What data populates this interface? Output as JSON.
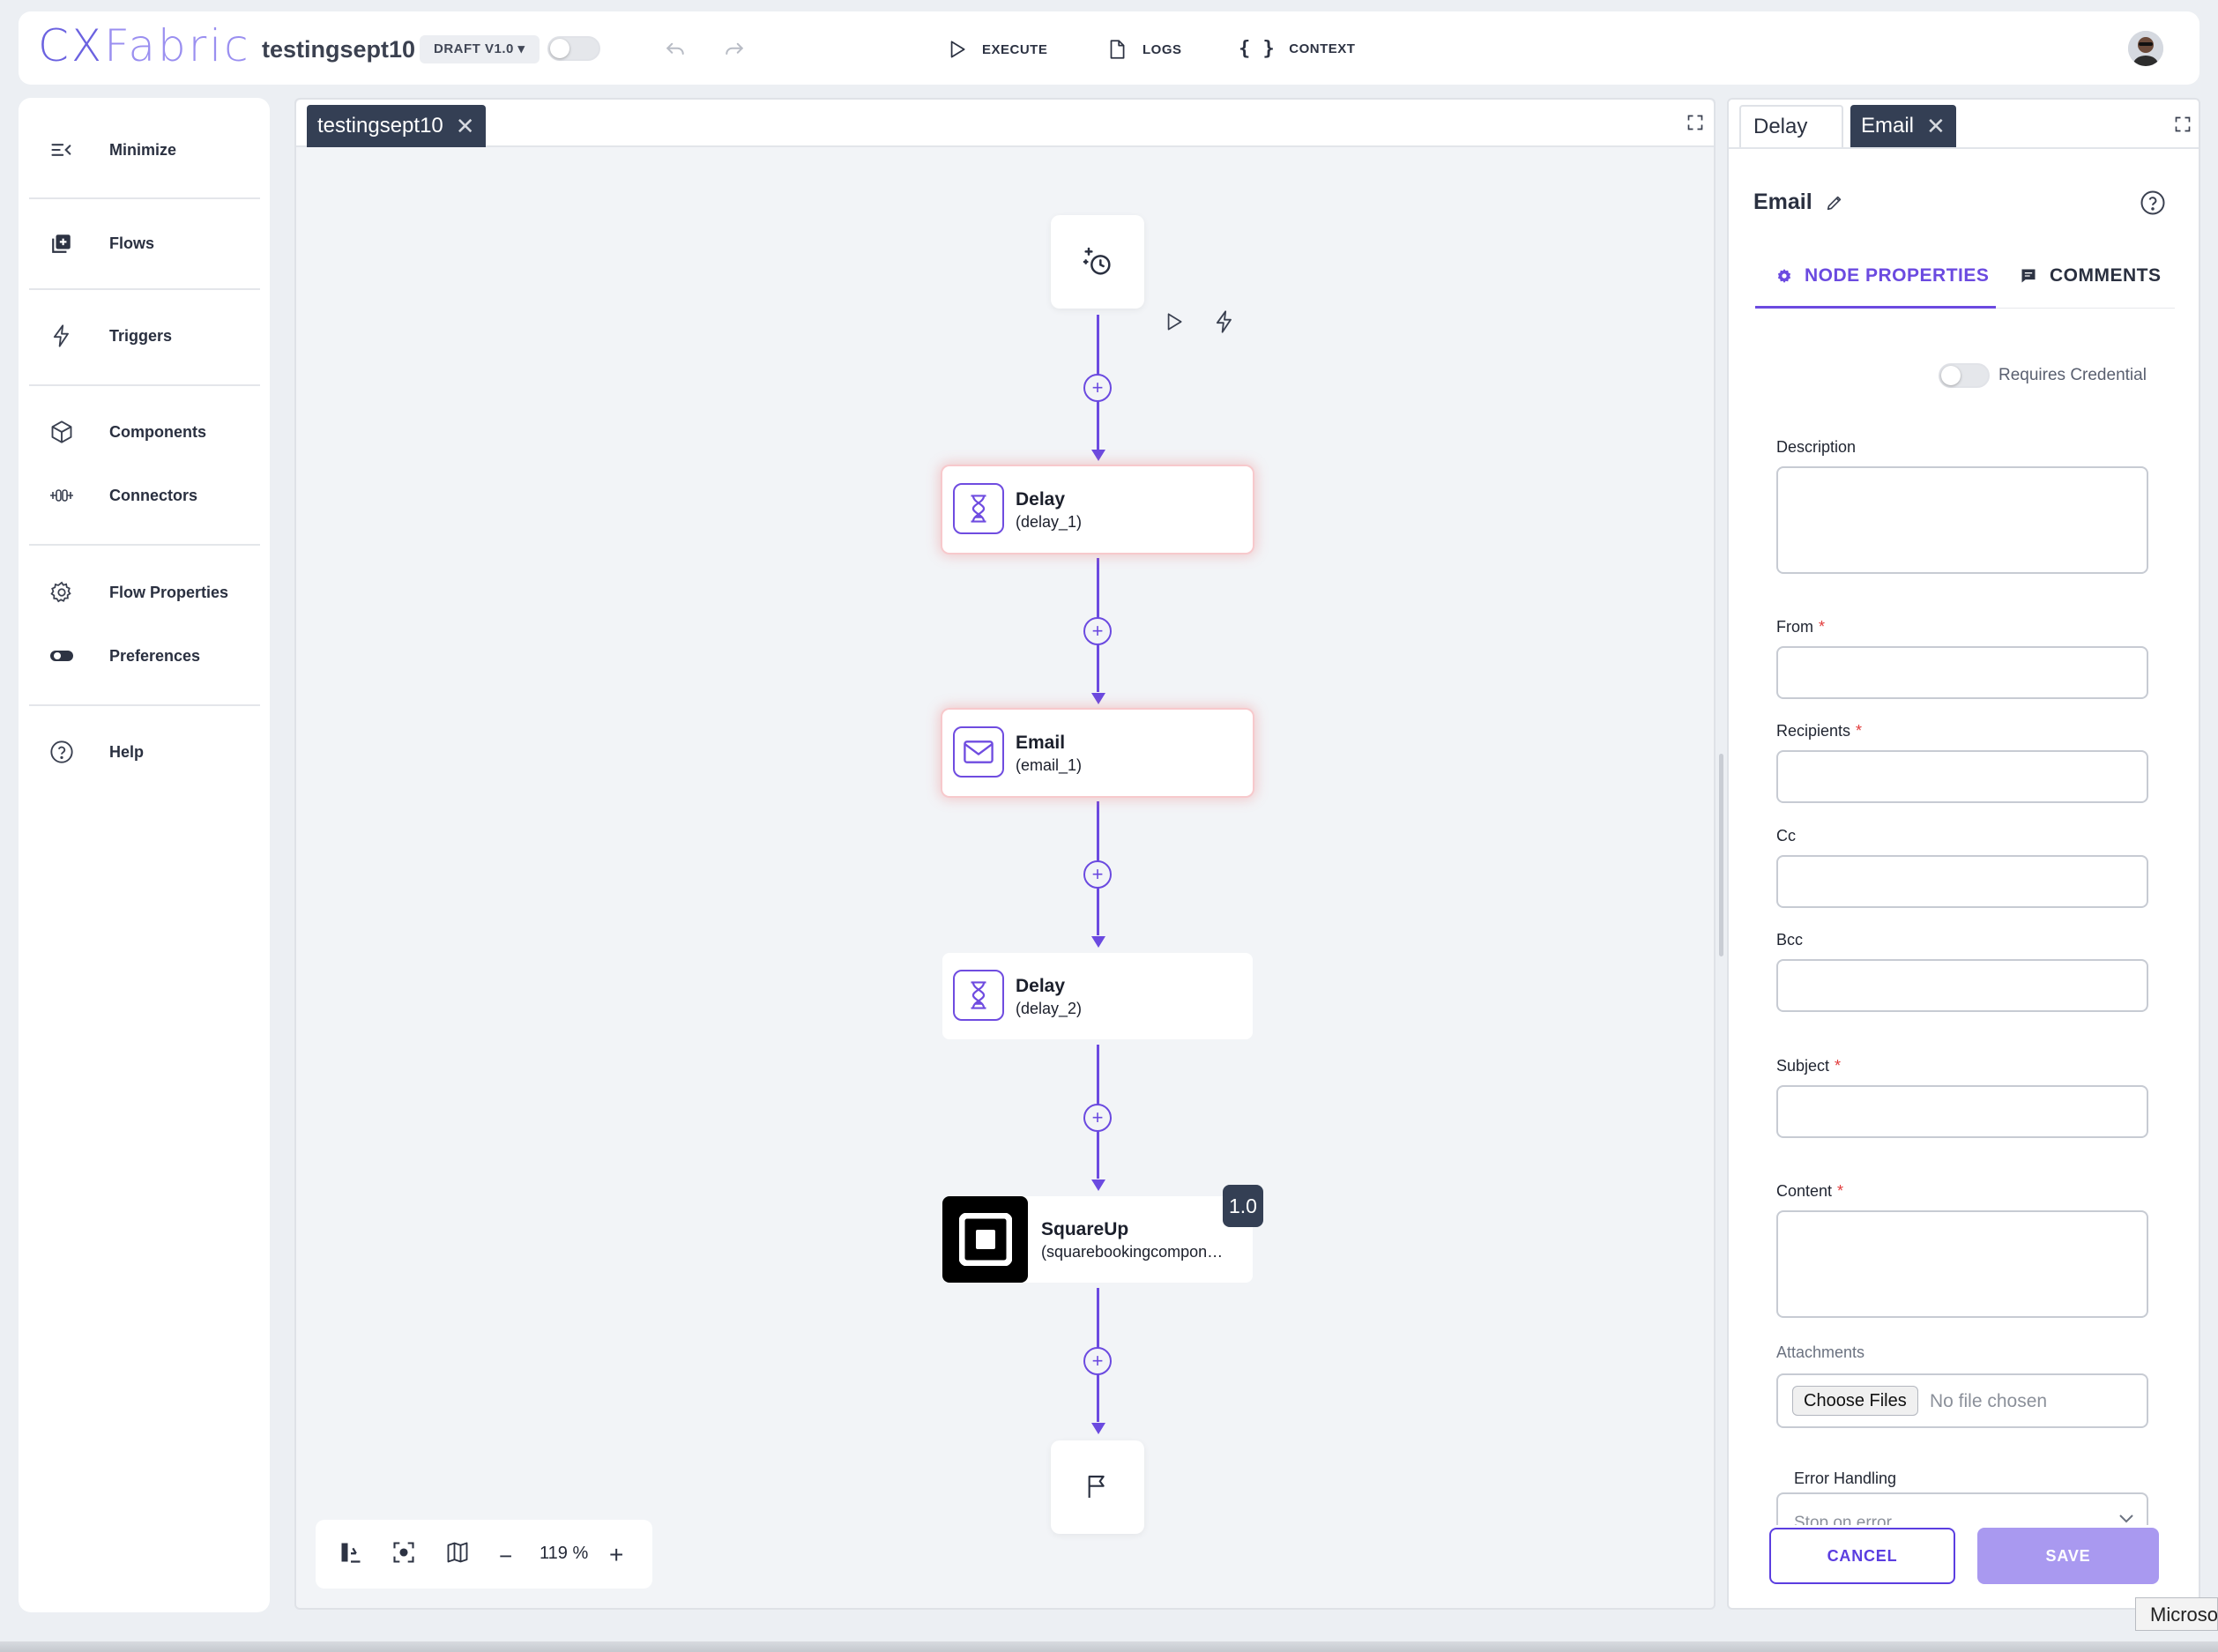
{
  "topbar": {
    "logo_part1": "CX",
    "logo_part2": "Fabric",
    "flow_name": "testingsept10",
    "draft_badge": "DRAFT V1.0 ▾",
    "actions": {
      "execute": "EXECUTE",
      "logs": "LOGS",
      "context": "CONTEXT"
    }
  },
  "sidebar": {
    "items": [
      {
        "label": "Minimize",
        "icon": "minimize-icon"
      },
      {
        "label": "Flows",
        "icon": "flows-icon"
      },
      {
        "label": "Triggers",
        "icon": "trigger-icon"
      },
      {
        "label": "Components",
        "icon": "cube-icon"
      },
      {
        "label": "Connectors",
        "icon": "connector-icon"
      },
      {
        "label": "Flow Properties",
        "icon": "gear-icon"
      },
      {
        "label": "Preferences",
        "icon": "toggle-icon"
      },
      {
        "label": "Help",
        "icon": "help-icon"
      }
    ]
  },
  "canvas": {
    "tab_label": "testingsept10",
    "nodes": [
      {
        "title": "Delay",
        "id": "(delay_1)",
        "icon": "hourglass-icon",
        "error": true
      },
      {
        "title": "Email",
        "id": "(email_1)",
        "icon": "mail-icon",
        "error": true
      },
      {
        "title": "Delay",
        "id": "(delay_2)",
        "icon": "hourglass-icon",
        "error": false
      },
      {
        "title": "SquareUp",
        "id": "(squarebookingcompon…",
        "icon": "squareup-logo-icon",
        "error": false
      }
    ],
    "component_version": "1.0",
    "zoom_level": "119 %"
  },
  "right_panel": {
    "tabs": [
      {
        "label": "Delay",
        "active": false
      },
      {
        "label": "Email",
        "active": true
      }
    ],
    "node_title": "Email",
    "subtabs": {
      "properties": "NODE PROPERTIES",
      "comments": "COMMENTS"
    },
    "requires_credential_label": "Requires Credential",
    "fields": {
      "description": "Description",
      "from": "From",
      "recipients": "Recipients",
      "cc": "Cc",
      "bcc": "Bcc",
      "subject": "Subject",
      "content": "Content",
      "attachments": "Attachments"
    },
    "required_mark": "*",
    "file_button": "Choose Files",
    "file_status": "No file chosen",
    "error_handling_label": "Error Handling",
    "error_handling_value": "Stop on error",
    "cancel_label": "CANCEL",
    "save_label": "SAVE"
  },
  "os": {
    "tooltip": "Microso"
  },
  "colors": {
    "accent": "#6b4ae0",
    "tab_dark": "#343f54",
    "save_button": "#a999f0",
    "error_glow": "#f7c9cc"
  }
}
